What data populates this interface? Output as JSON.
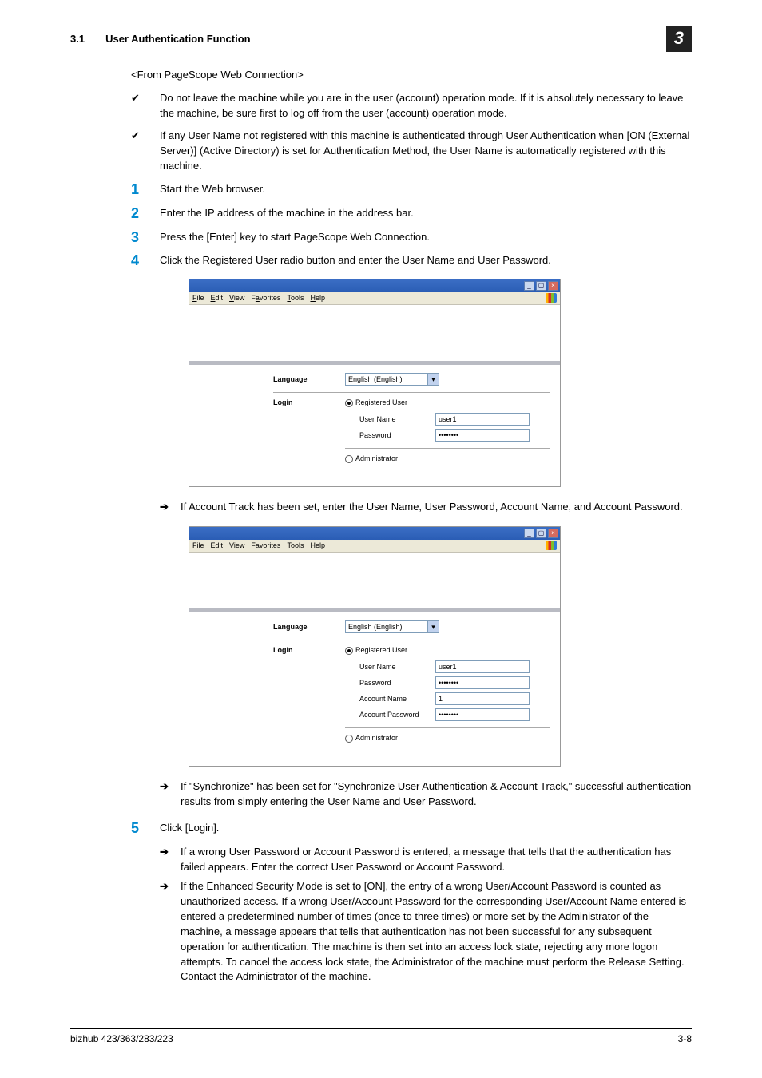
{
  "header": {
    "section_number": "3.1",
    "section_title": "User Authentication Function",
    "chapter": "3"
  },
  "content": {
    "angle": "<From PageScope Web Connection>",
    "checks": [
      "Do not leave the machine while you are in the user (account) operation mode. If it is absolutely necessary to leave the machine, be sure first to log off from the user (account) operation mode.",
      "If any User Name not registered with this machine is authenticated through User Authentication when [ON (External Server)] (Active Directory) is set for Authentication Method, the User Name is automatically registered with this machine."
    ],
    "steps": [
      "Start the Web browser.",
      "Enter the IP address of the machine in the address bar.",
      "Press the [Enter] key to start PageScope Web Connection.",
      "Click the Registered User radio button and enter the User Name and User Password.",
      "Click [Login]."
    ],
    "arrow1": "If Account Track has been set, enter the User Name, User Password, Account Name, and Account Password.",
    "arrow2": "If \"Synchronize\" has been set for \"Synchronize User Authentication & Account Track,\" successful authentication results from simply entering the User Name and User Password.",
    "arrow3": "If a wrong User Password or Account Password is entered, a message that tells that the authentication has failed appears. Enter the correct User Password or Account Password.",
    "arrow4": "If the Enhanced Security Mode is set to [ON], the entry of a wrong User/Account Password is counted as unauthorized access. If a wrong User/Account Password for the corresponding User/Account Name entered is entered a predetermined number of times (once to three times) or more set by the Administrator of the machine, a message appears that tells that authentication has not been successful for any subsequent operation for authentication. The machine is then set into an access lock state, rejecting any more logon attempts. To cancel the access lock state, the Administrator of the machine must perform the Release Setting. Contact the Administrator of the machine."
  },
  "shot": {
    "menus": {
      "file": "File",
      "edit": "Edit",
      "view": "View",
      "favorites": "Favorites",
      "tools": "Tools",
      "help": "Help"
    },
    "lang_lbl": "Language",
    "lang_val": "English (English)",
    "login_lbl": "Login",
    "reg_user": "Registered User",
    "user_name_lbl": "User Name",
    "user_name_val": "user1",
    "password_lbl": "Password",
    "password_val": "••••••••",
    "acct_name_lbl": "Account Name",
    "acct_name_val": "1",
    "acct_pw_lbl": "Account Password",
    "acct_pw_val": "••••••••",
    "admin": "Administrator"
  },
  "footer": {
    "left": "bizhub 423/363/283/223",
    "right": "3-8"
  }
}
